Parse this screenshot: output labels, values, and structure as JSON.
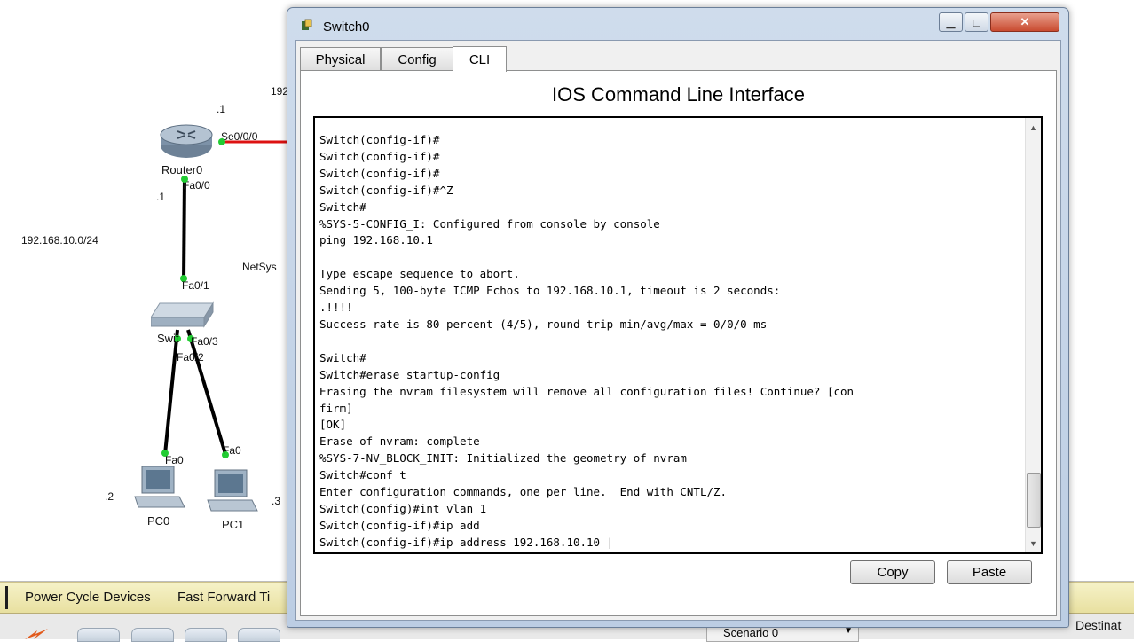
{
  "window": {
    "title": "Switch0",
    "tabs": [
      {
        "label": "Physical",
        "active": false
      },
      {
        "label": "Config",
        "active": false
      },
      {
        "label": "CLI",
        "active": true
      }
    ],
    "heading": "IOS Command Line Interface",
    "terminal_lines": [
      "Switch(config-if)#",
      "Switch(config-if)#",
      "Switch(config-if)#",
      "Switch(config-if)#^Z",
      "Switch#",
      "%SYS-5-CONFIG_I: Configured from console by console",
      "ping 192.168.10.1",
      "",
      "Type escape sequence to abort.",
      "Sending 5, 100-byte ICMP Echos to 192.168.10.1, timeout is 2 seconds:",
      ".!!!!",
      "Success rate is 80 percent (4/5), round-trip min/avg/max = 0/0/0 ms",
      "",
      "Switch#",
      "Switch#erase startup-config",
      "Erasing the nvram filesystem will remove all configuration files! Continue? [con",
      "firm]",
      "[OK]",
      "Erase of nvram: complete",
      "%SYS-7-NV_BLOCK_INIT: Initialized the geometry of nvram",
      "Switch#conf t",
      "Enter configuration commands, one per line.  End with CNTL/Z.",
      "Switch(config)#int vlan 1",
      "Switch(config-if)#ip add",
      "Switch(config-if)#ip address 192.168.10.10 |"
    ],
    "copy_label": "Copy",
    "paste_label": "Paste"
  },
  "topology": {
    "router": {
      "name": "Router0",
      "ip_suffix": ".1",
      "serial_port": "Se0/0/0",
      "fa_port": "Fa0/0",
      "fa_ip_suffix": ".1"
    },
    "network_label": "192.168.10.0/24",
    "partial_label_192": "192",
    "partial_label_netsys": "NetSys",
    "switch": {
      "name": "Switch0",
      "name_visible": "Swit",
      "port_up": "Fa0/1",
      "port_left": "Fa0/2",
      "port_right": "Fa0/3"
    },
    "pcs": [
      {
        "name": "PC0",
        "port": "Fa0",
        "ip_suffix": ".2"
      },
      {
        "name": "PC1",
        "port": "Fa0",
        "ip_suffix": ".3"
      }
    ]
  },
  "bottom_bar": {
    "power_cycle": "Power Cycle Devices",
    "fast_forward": "Fast Forward Ti",
    "scenario": "Scenario 0",
    "destination": "Destinat"
  },
  "colors": {
    "link_up": "#22cc33",
    "serial_link": "#dd1111",
    "realtime_strip": "#f3eebb"
  }
}
